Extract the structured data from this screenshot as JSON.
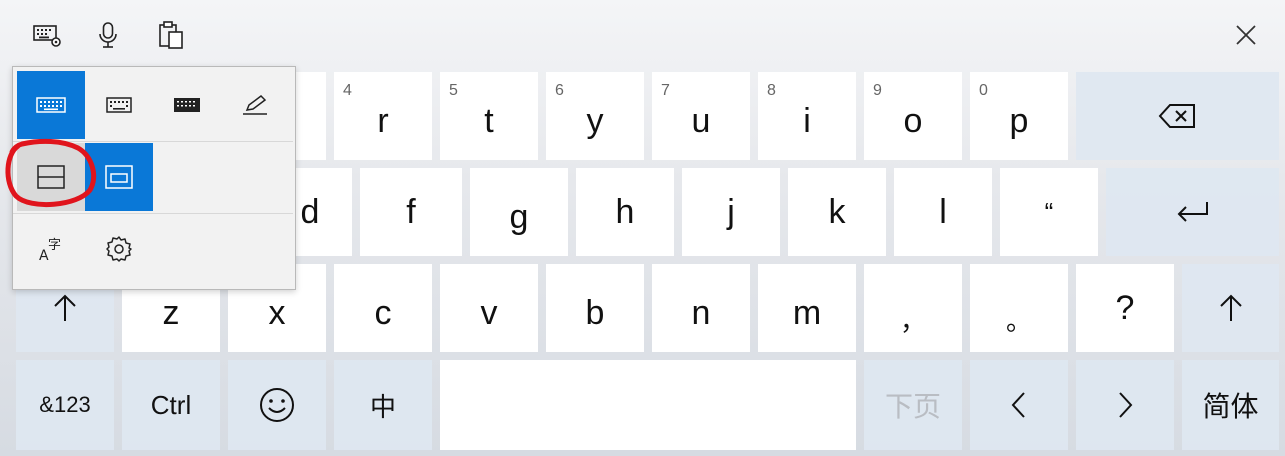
{
  "toolbar": {
    "icons": [
      "keyboard-settings-icon",
      "microphone-icon",
      "clipboard-icon"
    ],
    "close_icon": "close-icon"
  },
  "row1": [
    {
      "num": "4",
      "char": "r"
    },
    {
      "num": "5",
      "char": "t"
    },
    {
      "num": "6",
      "char": "y"
    },
    {
      "num": "7",
      "char": "u"
    },
    {
      "num": "8",
      "char": "i"
    },
    {
      "num": "9",
      "char": "o"
    },
    {
      "num": "0",
      "char": "p"
    }
  ],
  "row2": [
    "d",
    "f",
    "g",
    "h",
    "j",
    "k",
    "l",
    "“"
  ],
  "row3": [
    "z",
    "x",
    "c",
    "v",
    "b",
    "n",
    "m",
    "，",
    "。",
    "?"
  ],
  "row4": {
    "symbols": "&123",
    "ctrl": "Ctrl",
    "lang": "中",
    "next_page": "下页",
    "script": "简体"
  },
  "popup": {
    "layouts": [
      "default-keyboard-icon",
      "small-keyboard-icon",
      "full-keyboard-icon",
      "handwriting-icon"
    ],
    "docking": [
      "split-docked-icon",
      "undocked-icon"
    ],
    "extras": [
      "language-icon",
      "settings-gear-icon"
    ],
    "selected_layout": 0,
    "selected_docking": 1,
    "highlighted_docking": 0
  },
  "colors": {
    "accent": "#0a78d7",
    "annotation": "#e0141c",
    "key": "#ffffff"
  }
}
